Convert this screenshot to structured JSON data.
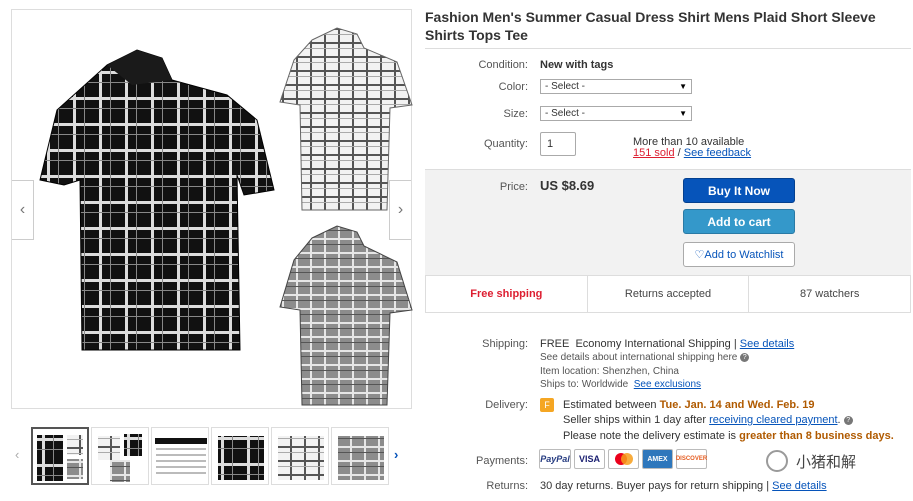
{
  "gallery": {
    "prev_arrow": "‹",
    "next_arrow": "›",
    "thumb_prev": "‹",
    "thumb_next": "›"
  },
  "title": "Fashion Men's Summer Casual Dress Shirt Mens Plaid Short Sleeve Shirts Tops Tee",
  "condition": {
    "label": "Condition:",
    "value": "New with tags"
  },
  "color": {
    "label": "Color:",
    "value": "- Select -"
  },
  "size": {
    "label": "Size:",
    "value": "- Select -"
  },
  "quantity": {
    "label": "Quantity:",
    "value": "1",
    "available": "More than 10 available",
    "sold": "151 sold",
    "separator": "/",
    "feedback": "See feedback"
  },
  "price": {
    "label": "Price:",
    "value": "US $8.69"
  },
  "buttons": {
    "buy": "Buy It Now",
    "cart": "Add to cart",
    "watch": "Add to Watchlist",
    "watch_icon": "♡"
  },
  "stats": {
    "shipping": "Free shipping",
    "returns": "Returns accepted",
    "watchers": "87 watchers"
  },
  "shipping": {
    "label": "Shipping:",
    "free": "FREE",
    "method": "Economy International Shipping",
    "divider": "|",
    "details_link": "See details",
    "intl_note": "See details about international shipping here",
    "location": "Item location:  Shenzhen, China",
    "ships_to": "Ships to:  Worldwide",
    "exclusions_link": "See exclusions"
  },
  "delivery": {
    "label": "Delivery:",
    "estimated_prefix": "Estimated between",
    "dates": "Tue. Jan. 14 and Wed. Feb. 19",
    "ships_prefix": "Seller ships within 1 day after",
    "ships_link": "receiving cleared payment",
    "ships_suffix": ".",
    "note_prefix": "Please note the delivery estimate is",
    "note_emph": "greater than 8 business days."
  },
  "payments": {
    "label": "Payments:",
    "methods": [
      "PayPal",
      "VISA",
      "MC",
      "AMEX",
      "DISCOVER"
    ]
  },
  "returns": {
    "label": "Returns:",
    "text": "30 day returns. Buyer pays for return shipping",
    "divider": "|",
    "link": "See details"
  },
  "watermark": "小猪和解",
  "colors": {
    "accent_blue": "#0654ba",
    "cart_blue": "#3498ca",
    "red": "#dd1e31",
    "orange": "#b05a00"
  }
}
